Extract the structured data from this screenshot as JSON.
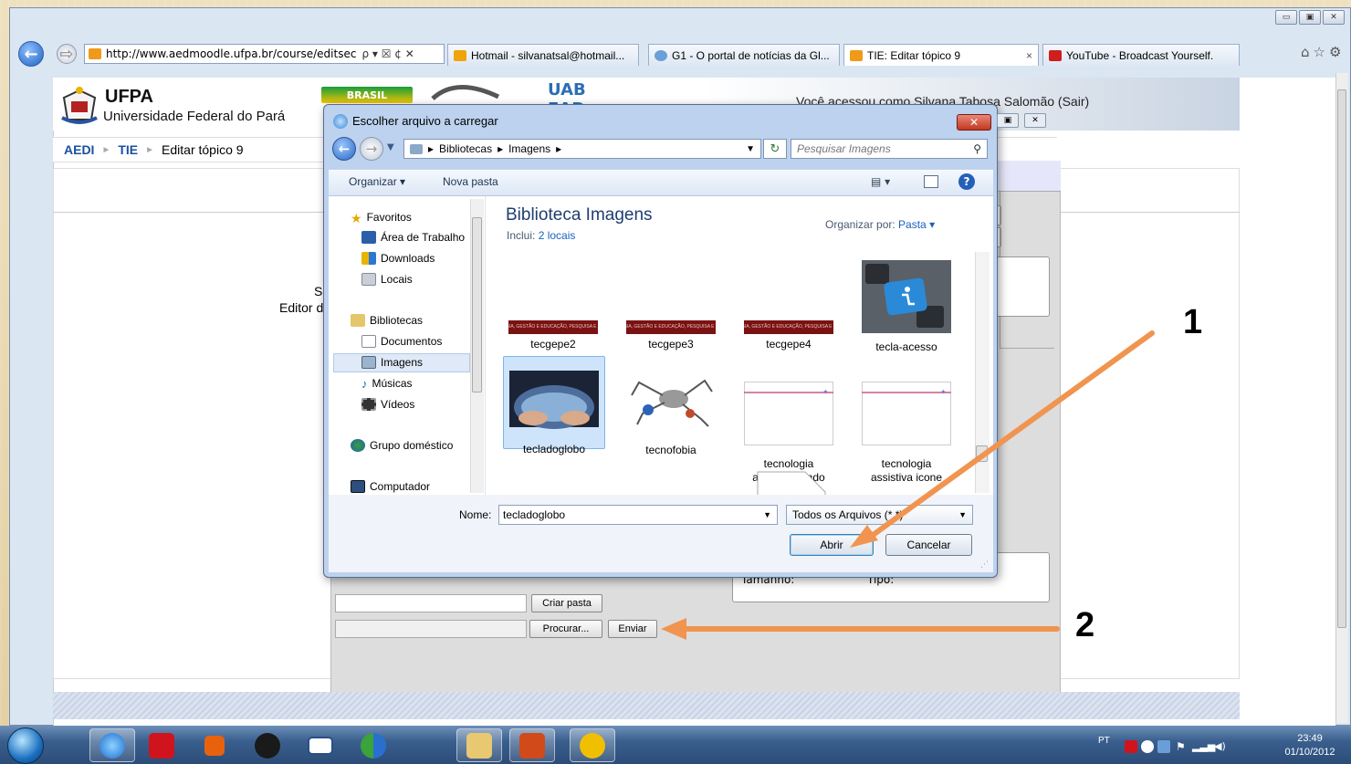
{
  "browser": {
    "address": "http://www.aedmoodle.ufpa.br/course/editsec",
    "address_search_glyph": "ρ ▾ ☒ ¢ ✕",
    "tabs": [
      {
        "label": "Hotmail - silvanatsal@hotmail...",
        "color": "#f0a30a"
      },
      {
        "label": "G1 - O portal de notícias da Gl...",
        "color": "#6a9fd8"
      },
      {
        "label": "TIE: Editar tópico 9",
        "color": "#f09a1a"
      },
      {
        "label": "YouTube - Broadcast Yourself.",
        "color": "#d01e1e"
      }
    ],
    "active_tab_close": "×",
    "window_controls": [
      "▭",
      "▣",
      "✕"
    ],
    "right_icons": "⌂☆⚙"
  },
  "site": {
    "logo_name": "UFPA",
    "logo_sub": "Universidade Federal do Pará",
    "brasil": "BRASIL",
    "uab": "UAB EAD",
    "user_info": "Você acessou como Silvana Tabosa Salomão (Sair)",
    "breadcrumb": [
      "AEDI",
      "TIE",
      "Editar tópico 9"
    ],
    "side_text1": "S",
    "side_text2": "Editor d"
  },
  "filemanager": {
    "size_label": "Tamanho:",
    "type_label": "Tipo:",
    "create_folder": "Criar pasta",
    "browse": "Procurar...",
    "send": "Enviar"
  },
  "dialog": {
    "title": "Escolher arquivo a carregar",
    "close": "✕",
    "path": [
      "Bibliotecas",
      "Imagens"
    ],
    "search_placeholder": "Pesquisar Imagens",
    "toolbar": {
      "organize": "Organizar ▾",
      "new_folder": "Nova pasta"
    },
    "nav": {
      "favorites": "Favoritos",
      "desktop": "Área de Trabalho",
      "downloads": "Downloads",
      "places": "Locais",
      "libraries": "Bibliotecas",
      "documents": "Documentos",
      "images": "Imagens",
      "music": "Músicas",
      "videos": "Vídeos",
      "homegroup": "Grupo doméstico",
      "computer": "Computador"
    },
    "library_title": "Biblioteca Imagens",
    "library_includes": "Inclui:",
    "library_locations": "2 locais",
    "sort_label": "Organizar por:",
    "sort_value": "Pasta ▾",
    "files": [
      {
        "name": "tecgepe2",
        "kind": "banner"
      },
      {
        "name": "tecgepe3",
        "kind": "banner"
      },
      {
        "name": "tecgepe4",
        "kind": "banner"
      },
      {
        "name": "tecla-acesso",
        "kind": "keyboard"
      },
      {
        "name": "tecladoglobo",
        "kind": "globe",
        "selected": true
      },
      {
        "name": "tecnofobia",
        "kind": "robot"
      },
      {
        "name": "tecnologia\nassistiva fundo",
        "kind": "blank"
      },
      {
        "name": "tecnologia\nassistiva icone",
        "kind": "blank"
      }
    ],
    "banner_text": "TECNOLOGIA, GESTÃO E EDUCAÇÃO, PESQUISA E EXTENSÃO",
    "name_label": "Nome:",
    "name_value": "tecladoglobo",
    "filter_value": "Todos os Arquivos (*.*)",
    "open": "Abrir",
    "cancel": "Cancelar"
  },
  "annotations": {
    "one": "1",
    "two": "2",
    "arrow_color": "#f0944f"
  },
  "taskbar": {
    "lang": "PT",
    "time": "23:49",
    "date": "01/10/2012",
    "apps": [
      "internet-explorer",
      "avira",
      "media-player",
      "hp",
      "mail",
      "messenger",
      "file-explorer",
      "powerpoint",
      "sw-app"
    ]
  }
}
